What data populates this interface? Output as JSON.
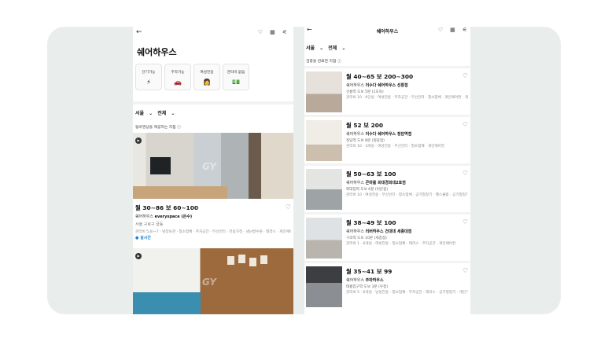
{
  "left": {
    "title": "쉐어하우스",
    "categories": [
      {
        "label": "단기가능",
        "icon": "⚡"
      },
      {
        "label": "주차가능",
        "icon": "🚗"
      },
      {
        "label": "여성전용",
        "icon": "👩"
      },
      {
        "label": "관리비 없음",
        "icon": "💵"
      }
    ],
    "filter_region": "서울",
    "filter_all": "전체",
    "notice": "동바영상을 제공하는 지점",
    "listing": {
      "watermark": "GY",
      "price": "월 30~86  보 60~100",
      "type": "쉐어하우스",
      "name": "everyspace (은수)",
      "location": "서울 구로구 궁동",
      "options": "관리비 5,6/~7 · 냉장보관 · 청소업체 · 주차공간 · 무선인터 · 전용가전 · 냉난방수원 · 테라스 · 개인에어컨",
      "badge": "실시간"
    },
    "watermark2": "GY"
  },
  "right": {
    "title": "쉐어하우스",
    "filter_region": "서울",
    "filter_all": "전체",
    "notice": "검증을 완료한 지점",
    "items": [
      {
        "price": "월 40~65  보 200~300",
        "type": "쉐어하우스",
        "name": "더수다 쉐어하우스 선릉점",
        "dist": "선릉역 도보 5분 (1호차)",
        "opts": "관리비 10 · 6인실 · 여성전용 · 주차공간 · 무선인터 · 청소업체 · 개인에어컨 · 개인"
      },
      {
        "price": "월 52  보 200",
        "type": "쉐어하우스",
        "name": "더수다 쉐어하우스 정담역점",
        "dist": "정담역 도보 8분 (정담점)",
        "opts": "관리비 10 · 3개실 · 여성전용 · 무선인터 · 청소업체 · 개인에어컨"
      },
      {
        "price": "월 50~63  보 100",
        "type": "쉐어하우스",
        "name": "콘마를 회대경희대2호점",
        "dist": "회대입역 도보 6분 (어문점)",
        "opts": "관리비 10 · 여성전용 · 무선인터 · 청소업체 · 공기청정기 · 헬스클럽 · 공기청정기"
      },
      {
        "price": "월 38~49  보 100",
        "type": "쉐어하우스",
        "name": "리버하우스 건대대 세종대점",
        "dist": "구의역 도보 10분 (세종점)",
        "opts": "관리비 1 · 6개실 · 여성전용 · 청소업체 · 테라스 · 주차공간 · 개인에어컨"
      },
      {
        "price": "월 35~41  보 99",
        "type": "쉐어하우스",
        "name": "주마하우스",
        "dist": "태릉입구역 도보 3분 (우정)",
        "opts": "관리비 5 · 6개실 · 남성전용 · 청소업체 · 주차공간 · 테라스 · 공기청정기 · 개인가구"
      }
    ]
  }
}
